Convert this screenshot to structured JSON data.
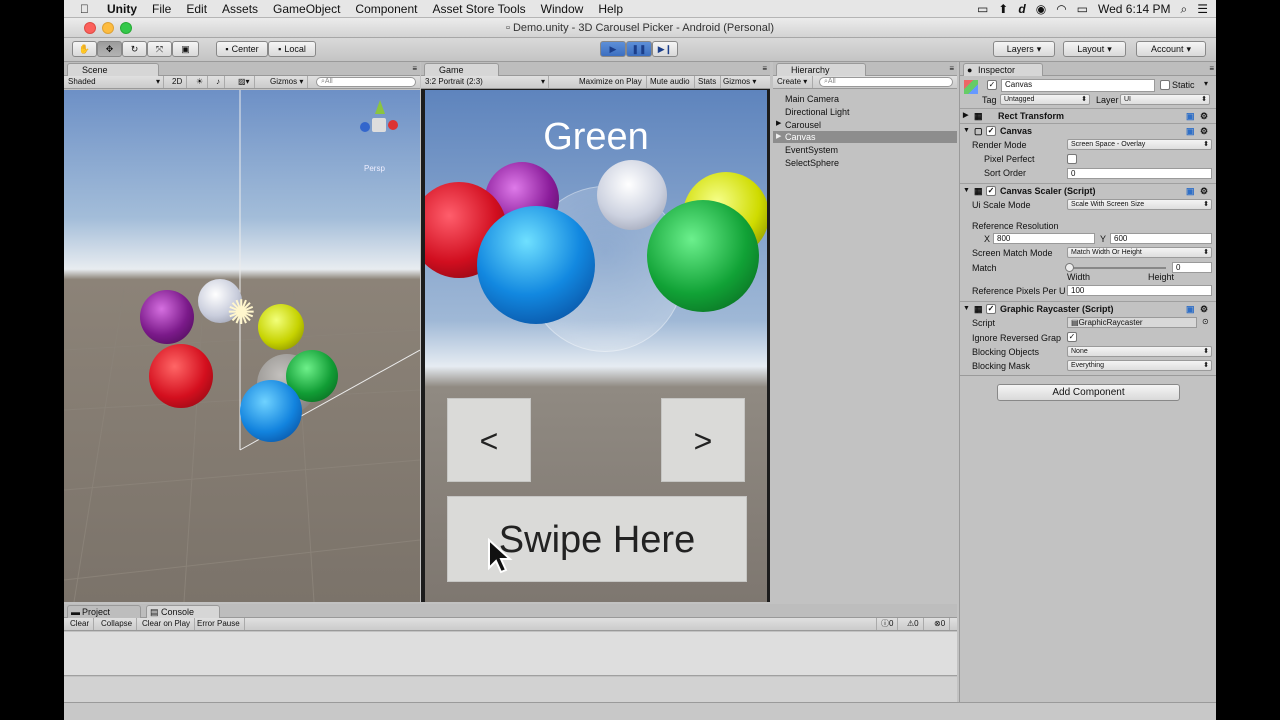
{
  "menubar": {
    "app": "Unity",
    "items": [
      "File",
      "Edit",
      "Assets",
      "GameObject",
      "Component",
      "Asset Store Tools",
      "Window",
      "Help"
    ],
    "clock": "Wed 6:14 PM"
  },
  "window": {
    "title": "Demo.unity - 3D Carousel Picker - Android (Personal)"
  },
  "toolbar": {
    "center": "Center",
    "local": "Local",
    "layers": "Layers",
    "layout": "Layout",
    "account": "Account"
  },
  "scene": {
    "tab": "Scene",
    "shading": "Shaded",
    "mode2d": "2D",
    "gizmos": "Gizmos",
    "search": "All",
    "persp": "Persp"
  },
  "game": {
    "tab": "Game",
    "aspect": "3:2 Portrait (2:3)",
    "maximize": "Maximize on Play",
    "mute": "Mute audio",
    "stats": "Stats",
    "gizmos": "Gizmos",
    "selected_label": "Green",
    "prev": "<",
    "next": ">",
    "swipe": "Swipe Here"
  },
  "hierarchy": {
    "tab": "Hierarchy",
    "create": "Create",
    "search": "All",
    "items": [
      "Main Camera",
      "Directional Light",
      "Carousel",
      "Canvas",
      "EventSystem",
      "SelectSphere"
    ]
  },
  "inspector": {
    "tab": "Inspector",
    "object_name": "Canvas",
    "static": "Static",
    "tag_label": "Tag",
    "tag_value": "Untagged",
    "layer_label": "Layer",
    "layer_value": "UI",
    "rect_transform": "Rect Transform",
    "canvas": {
      "title": "Canvas",
      "render_mode_label": "Render Mode",
      "render_mode": "Screen Space - Overlay",
      "pixel_perfect": "Pixel Perfect",
      "sort_order_label": "Sort Order",
      "sort_order": "0"
    },
    "scaler": {
      "title": "Canvas Scaler (Script)",
      "ui_scale_label": "Ui Scale Mode",
      "ui_scale": "Scale With Screen Size",
      "ref_res": "Reference Resolution",
      "x_label": "X",
      "x": "800",
      "y_label": "Y",
      "y": "600",
      "match_mode_label": "Screen Match Mode",
      "match_mode": "Match Width Or Height",
      "match_label": "Match",
      "match_value": "0",
      "width": "Width",
      "height": "Height",
      "ppu_label": "Reference Pixels Per U",
      "ppu": "100"
    },
    "raycaster": {
      "title": "Graphic Raycaster (Script)",
      "script_label": "Script",
      "script": "GraphicRaycaster",
      "ignore_label": "Ignore Reversed Grap",
      "blocking_objects_label": "Blocking Objects",
      "blocking_objects": "None",
      "blocking_mask_label": "Blocking Mask",
      "blocking_mask": "Everything"
    },
    "add_component": "Add Component"
  },
  "bottom": {
    "project_tab": "Project",
    "console_tab": "Console",
    "clear": "Clear",
    "collapse": "Collapse",
    "clear_on_play": "Clear on Play",
    "error_pause": "Error Pause",
    "count_info": "0",
    "count_warn": "0",
    "count_error": "0"
  }
}
